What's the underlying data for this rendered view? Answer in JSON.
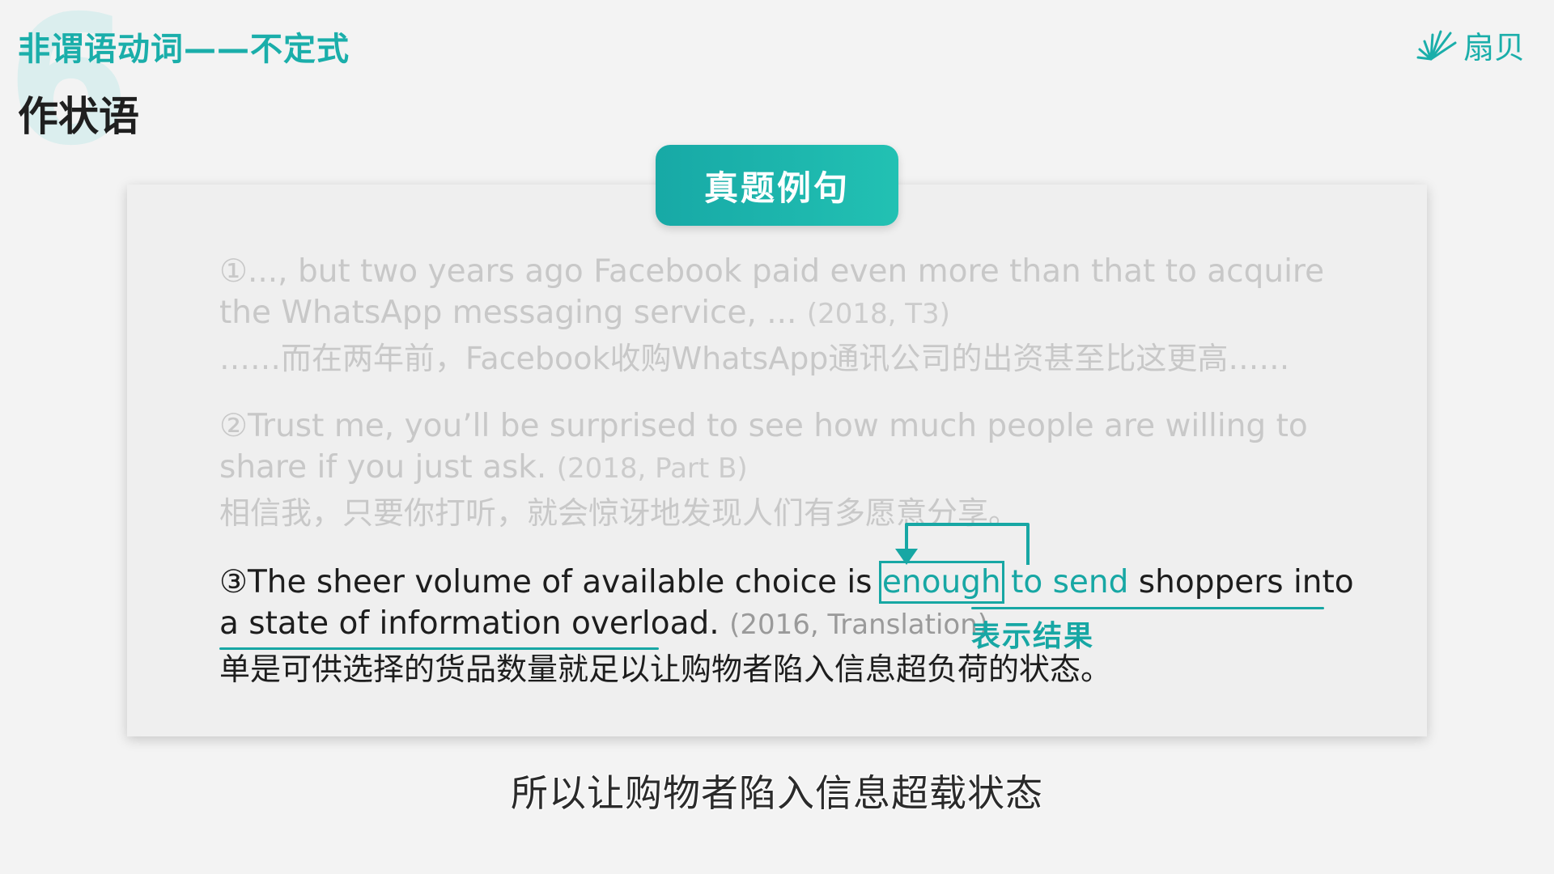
{
  "header": {
    "big_number": "6",
    "section_title": "非谓语动词——不定式",
    "sub_title": "作状语"
  },
  "logo": {
    "text": "扇贝",
    "icon": "sunburst-icon"
  },
  "tag": {
    "label": "真题例句"
  },
  "examples": [
    {
      "en": "①..., but two years ago Facebook paid even more than that to acquire the WhatsApp messaging service, ...",
      "source": "(2018, T3)",
      "zh": "……而在两年前，Facebook收购WhatsApp通讯公司的出资甚至比这更高……"
    },
    {
      "en": "②Trust me, you’ll be surprised to see how much people are willing to share if you just ask.",
      "source": "(2018, Part B)",
      "zh": "相信我，只要你打听，就会惊讶地发现人们有多愿意分享。"
    },
    {
      "en_before": "③The sheer volume of available choice is ",
      "en_enough": "enough",
      "en_tosend": "to send",
      "en_after": " shoppers into a state of information overload.",
      "source": "(2016, Translation)",
      "zh": "单是可供选择的货品数量就足以让购物者陷入信息超负荷的状态。"
    }
  ],
  "annotation": {
    "label": "表示结果"
  },
  "colors": {
    "accent": "#17a7a4",
    "faded_text": "#c8c8c8",
    "main_text": "#1d1d1d"
  },
  "subtitle": {
    "text": "所以让购物者陷入信息超载状态"
  }
}
